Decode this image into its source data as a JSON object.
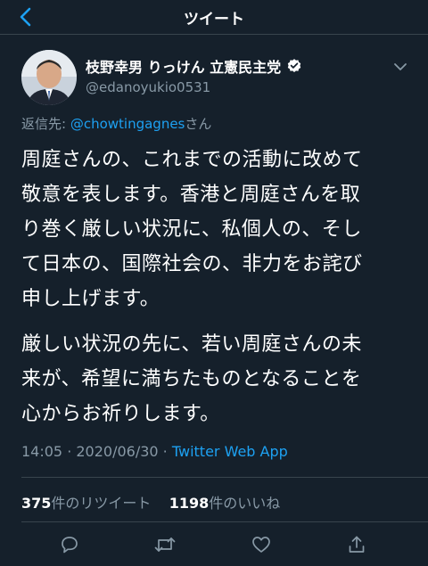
{
  "header": {
    "title": "ツイート",
    "back_icon": "chevron-left-icon"
  },
  "author": {
    "name": "枝野幸男 りっけん 立憲民主党",
    "handle": "@edanoyukio0531",
    "verified_icon": "verified-badge-icon",
    "menu_icon": "chevron-down-icon"
  },
  "reply": {
    "prefix": "返信先: ",
    "mention": "@chowtingagnes",
    "suffix": "さん"
  },
  "tweet": {
    "paragraph1": "周庭さんの、これまでの活動に改めて\n敬意を表します。香港と周庭さんを取\nり巻く厳しい状況に、私個人の、そし\nて日本の、国際社会の、非力をお詫び\n申し上げます。",
    "paragraph2": "厳しい状況の先に、若い周庭さんの未\n来が、希望に満ちたものとなることを\n心からお祈りします。"
  },
  "meta": {
    "time": "14:05",
    "separator": " · ",
    "date": "2020/06/30",
    "app": "Twitter Web App"
  },
  "stats": {
    "retweets": "375",
    "retweets_label": "件のリツイート",
    "likes": "1198",
    "likes_label": "件のいいね"
  },
  "colors": {
    "background": "#15202b",
    "accent": "#1da1f2",
    "muted": "#8899a6",
    "border": "#38444d"
  }
}
